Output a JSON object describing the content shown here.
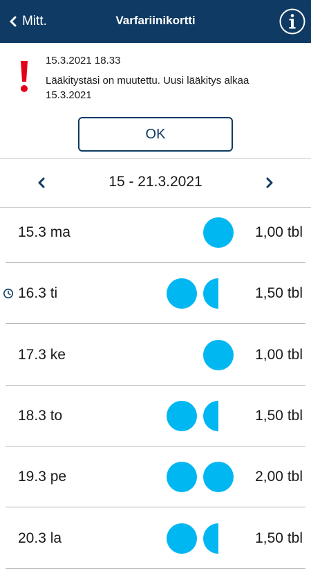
{
  "header": {
    "back_label": "Mitt.",
    "title": "Varfariinikortti"
  },
  "alert": {
    "datetime": "15.3.2021 18.33",
    "message": "Lääkitystäsi on muutettu. Uusi lääkitys alkaa 15.3.2021",
    "ok_label": "OK"
  },
  "week": {
    "label": "15 - 21.3.2021"
  },
  "colors": {
    "header_bg": "#0f3a63",
    "pill": "#00b7f1",
    "alert_icon": "#e3001b"
  },
  "days": [
    {
      "label": "15.3 ma",
      "amount": "1,00 tbl",
      "pills": [
        "full"
      ],
      "current": false
    },
    {
      "label": "16.3 ti",
      "amount": "1,50 tbl",
      "pills": [
        "full",
        "half"
      ],
      "current": true
    },
    {
      "label": "17.3 ke",
      "amount": "1,00 tbl",
      "pills": [
        "full"
      ],
      "current": false
    },
    {
      "label": "18.3 to",
      "amount": "1,50 tbl",
      "pills": [
        "full",
        "half"
      ],
      "current": false
    },
    {
      "label": "19.3 pe",
      "amount": "2,00 tbl",
      "pills": [
        "full",
        "full"
      ],
      "current": false
    },
    {
      "label": "20.3 la",
      "amount": "1,50 tbl",
      "pills": [
        "full",
        "half"
      ],
      "current": false
    }
  ]
}
